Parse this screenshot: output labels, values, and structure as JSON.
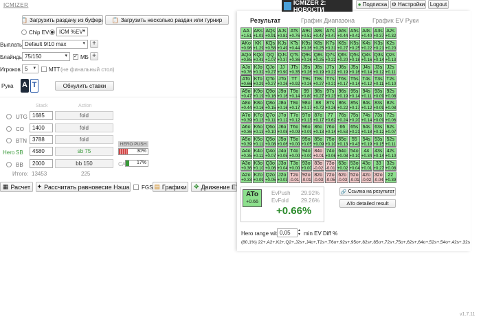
{
  "app": {
    "logo": "ICMIZER",
    "banner": "ICMIZER 2: НОВОСТИ",
    "version": "v1.7.11"
  },
  "topnav": {
    "subscription": "Подписка",
    "settings": "Настройки",
    "logout": "Logout"
  },
  "toolbar": {
    "load_hand": "Загрузить раздачу из буфера",
    "load_many": "Загрузить несколько раздач или турнир"
  },
  "model": {
    "chip_ev": "Chip EV",
    "icm": "ICM %EV"
  },
  "payouts": {
    "label": "Выплаты",
    "value": "Default 9/10 max"
  },
  "blinds": {
    "label": "Блайнды",
    "value": "75/150",
    "mb_label": "МБ"
  },
  "players": {
    "label": "Игроков",
    "value": "5",
    "mtt_label": "MTT",
    "final_note": "(не финальный стол)"
  },
  "hand": {
    "label": "Рука",
    "card1": "A",
    "card2": "T",
    "reset": "Обнулить ставки"
  },
  "table_head": {
    "stack": "Stack",
    "action": "Action"
  },
  "seats": [
    {
      "pos": "UTG",
      "stack": "1685",
      "action": "fold"
    },
    {
      "pos": "CO",
      "stack": "1400",
      "action": "fold"
    },
    {
      "pos": "BTN",
      "stack": "3788",
      "action": "fold"
    },
    {
      "pos": "SB",
      "hero": "Hero",
      "stack": "4580",
      "action": "sb 75"
    },
    {
      "pos": "BB",
      "stack": "2000",
      "action": "bb 150"
    }
  ],
  "totals": {
    "label": "Итого:",
    "stack": "13453",
    "action": "225"
  },
  "hero_push": {
    "label": "HERO PUSH",
    "value": "30%",
    "ca_label": "CA",
    "ca_value": "17%",
    "push_fraction": 0.3,
    "ca_fraction": 0.17
  },
  "bottom": {
    "calc": "Расчет",
    "nash": "Рассчитать равновесие Нэша",
    "fgs": "FGS",
    "graphs": "Графики",
    "ev_move": "Движение EV"
  },
  "tabs": {
    "result": "Результат",
    "range_graph": "График Диапазона",
    "ev_graph": "График EV Руки"
  },
  "summary": {
    "hand": "ATo",
    "hand_ev": "+0.66",
    "evpush_label": "EvPush",
    "evpush": "29.92%",
    "evfold_label": "EvFold",
    "evfold": "29.26%",
    "diff": "+0.66%",
    "link": "Ссылка на результат",
    "detailed": "ATo detailed result"
  },
  "hero_range": {
    "label": "Hero range with",
    "value": "0,05",
    "suffix": "min EV Diff %",
    "range": "(80,1%) 22+,A2+,K2+,Q2+,J2s+,J4o+,T2s+,T6o+,92s+,95o+,82s+,85o+,72s+,75o+,62s+,64o+,52s+,54o+,42s+,32s"
  },
  "grid": [
    [
      "AA",
      "+1.51",
      "g"
    ],
    [
      "AKs",
      "+1.03",
      "g"
    ],
    [
      "AQs",
      "+0.91",
      "g"
    ],
    [
      "AJs",
      "+0.81",
      "g"
    ],
    [
      "ATs",
      "+0.76",
      "g"
    ],
    [
      "A9s",
      "+0.52",
      "g"
    ],
    [
      "A8s",
      "+0.47",
      "g"
    ],
    [
      "A7s",
      "+0.47",
      "g"
    ],
    [
      "A6s",
      "+0.44",
      "g"
    ],
    [
      "A5s",
      "+0.42",
      "g"
    ],
    [
      "A4s",
      "+0.40",
      "g"
    ],
    [
      "A3s",
      "+0.37",
      "g"
    ],
    [
      "A2s",
      "+0.32",
      "g"
    ],
    [
      "AKo",
      "+0.96",
      "g"
    ],
    [
      "KK",
      "+1.29",
      "g"
    ],
    [
      "KQs",
      "+0.58",
      "g"
    ],
    [
      "KJs",
      "+0.49",
      "g"
    ],
    [
      "KTs",
      "+0.44",
      "g"
    ],
    [
      "K9s",
      "+0.36",
      "g"
    ],
    [
      "K8s",
      "+0.25",
      "g"
    ],
    [
      "K7s",
      "+0.31",
      "g"
    ],
    [
      "K6s",
      "+0.27",
      "g"
    ],
    [
      "K5s",
      "+0.25",
      "g"
    ],
    [
      "K4s",
      "+0.22",
      "g"
    ],
    [
      "K3s",
      "+0.21",
      "g"
    ],
    [
      "K2s",
      "+0.20",
      "g"
    ],
    [
      "AQo",
      "+0.85",
      "g"
    ],
    [
      "KQo",
      "+0.43",
      "g"
    ],
    [
      "QQ",
      "+1.07",
      "g"
    ],
    [
      "QJs",
      "+0.37",
      "g"
    ],
    [
      "QTs",
      "+0.36",
      "g"
    ],
    [
      "Q9s",
      "+0.26",
      "g"
    ],
    [
      "Q8s",
      "+0.25",
      "g"
    ],
    [
      "Q7s",
      "+0.22",
      "g"
    ],
    [
      "Q6s",
      "+0.20",
      "g"
    ],
    [
      "Q5s",
      "+0.18",
      "g"
    ],
    [
      "Q4s",
      "+0.16",
      "g"
    ],
    [
      "Q3s",
      "+0.14",
      "g"
    ],
    [
      "Q2s",
      "+0.13",
      "g"
    ],
    [
      "AJo",
      "+0.76",
      "g"
    ],
    [
      "KJo",
      "+0.32",
      "g"
    ],
    [
      "QJo",
      "+0.27",
      "g"
    ],
    [
      "JJ",
      "+0.90",
      "g"
    ],
    [
      "JTs",
      "+0.35",
      "g"
    ],
    [
      "J9s",
      "+0.26",
      "g"
    ],
    [
      "J8s",
      "+0.19",
      "g"
    ],
    [
      "J7s",
      "+0.22",
      "g"
    ],
    [
      "J6s",
      "+0.19",
      "g"
    ],
    [
      "J5s",
      "+0.16",
      "g"
    ],
    [
      "J4s",
      "+0.14",
      "g"
    ],
    [
      "J3s",
      "+0.12",
      "g"
    ],
    [
      "J2s",
      "+0.11",
      "g"
    ],
    [
      "ATo",
      "+0.66",
      "g"
    ],
    [
      "KTo",
      "+0.29",
      "g"
    ],
    [
      "QTo",
      "+0.27",
      "g"
    ],
    [
      "JTo",
      "+0.26",
      "g"
    ],
    [
      "TT",
      "+0.92",
      "g"
    ],
    [
      "T9s",
      "+0.26",
      "g"
    ],
    [
      "T8s",
      "+0.27",
      "g"
    ],
    [
      "T7s",
      "+0.21",
      "g"
    ],
    [
      "T6s",
      "+0.17",
      "g"
    ],
    [
      "T5s",
      "+0.14",
      "g"
    ],
    [
      "T4s",
      "+0.12",
      "g"
    ],
    [
      "T3s",
      "+0.11",
      "g"
    ],
    [
      "T2s",
      "+0.10",
      "g"
    ],
    [
      "A9o",
      "+0.47",
      "g"
    ],
    [
      "K9o",
      "+0.19",
      "g"
    ],
    [
      "Q9o",
      "+0.16",
      "g"
    ],
    [
      "J9o",
      "+0.16",
      "g"
    ],
    [
      "T9o",
      "+0.14",
      "g"
    ],
    [
      "99",
      "+0.80",
      "g"
    ],
    [
      "98s",
      "+0.27",
      "g"
    ],
    [
      "97s",
      "+0.23",
      "g"
    ],
    [
      "96s",
      "+0.19",
      "g"
    ],
    [
      "95s",
      "+0.14",
      "g"
    ],
    [
      "94s",
      "+0.11",
      "g"
    ],
    [
      "93s",
      "+0.09",
      "g"
    ],
    [
      "92s",
      "+0.08",
      "g"
    ],
    [
      "A8o",
      "+0.44",
      "g"
    ],
    [
      "K8o",
      "+0.16",
      "g"
    ],
    [
      "Q8o",
      "+0.15",
      "g"
    ],
    [
      "J8o",
      "+0.16",
      "g"
    ],
    [
      "T8o",
      "+0.17",
      "g"
    ],
    [
      "98o",
      "+0.17",
      "g"
    ],
    [
      "88",
      "+0.72",
      "g"
    ],
    [
      "87s",
      "+0.26",
      "g"
    ],
    [
      "86s",
      "+0.22",
      "g"
    ],
    [
      "85s",
      "+0.17",
      "g"
    ],
    [
      "84s",
      "+0.12",
      "g"
    ],
    [
      "83s",
      "+0.09",
      "g"
    ],
    [
      "82s",
      "+0.08",
      "g"
    ],
    [
      "A7o",
      "+0.39",
      "g"
    ],
    [
      "K7o",
      "+0.13",
      "g"
    ],
    [
      "Q7o",
      "+0.11",
      "g"
    ],
    [
      "J7o",
      "+0.12",
      "g"
    ],
    [
      "T7o",
      "+0.12",
      "g"
    ],
    [
      "97o",
      "+0.13",
      "g"
    ],
    [
      "87o",
      "+0.17",
      "g"
    ],
    [
      "77",
      "+0.62",
      "g"
    ],
    [
      "76s",
      "+0.24",
      "g"
    ],
    [
      "75s",
      "+0.20",
      "g"
    ],
    [
      "74s",
      "+0.14",
      "g"
    ],
    [
      "73s",
      "+0.09",
      "g"
    ],
    [
      "72s",
      "+0.06",
      "g"
    ],
    [
      "A6o",
      "+0.36",
      "g"
    ],
    [
      "K6o",
      "+0.13",
      "g"
    ],
    [
      "Q6o",
      "+0.10",
      "g"
    ],
    [
      "J6o",
      "+0.08",
      "g"
    ],
    [
      "T6o",
      "+0.09",
      "g"
    ],
    [
      "96o",
      "+0.09",
      "g"
    ],
    [
      "86o",
      "+0.13",
      "g"
    ],
    [
      "76o",
      "+0.14",
      "g"
    ],
    [
      "66",
      "+0.53",
      "g"
    ],
    [
      "65s",
      "+0.21",
      "g"
    ],
    [
      "64s",
      "+0.18",
      "g"
    ],
    [
      "63s",
      "+0.12",
      "g"
    ],
    [
      "62s",
      "+0.07",
      "g"
    ],
    [
      "A5o",
      "+0.39",
      "g"
    ],
    [
      "K5o",
      "+0.11",
      "g"
    ],
    [
      "Q5o",
      "+0.08",
      "g"
    ],
    [
      "J5o",
      "+0.06",
      "g"
    ],
    [
      "T5o",
      "+0.00",
      "g"
    ],
    [
      "95o",
      "+0.05",
      "g"
    ],
    [
      "85o",
      "+0.09",
      "g"
    ],
    [
      "75o",
      "+0.10",
      "g"
    ],
    [
      "65o",
      "+0.13",
      "g"
    ],
    [
      "55",
      "+0.43",
      "g"
    ],
    [
      "54s",
      "+0.19",
      "g"
    ],
    [
      "53s",
      "+0.15",
      "g"
    ],
    [
      "52s",
      "+0.11",
      "g"
    ],
    [
      "A4o",
      "+0.35",
      "g"
    ],
    [
      "K4o",
      "+0.11",
      "g"
    ],
    [
      "Q4o",
      "+0.07",
      "g"
    ],
    [
      "J4o",
      "+0.05",
      "g"
    ],
    [
      "T4o",
      "+0.00",
      "g"
    ],
    [
      "94o",
      "+0.00",
      "g"
    ],
    [
      "84o",
      "+0.01",
      "r"
    ],
    [
      "74o",
      "+0.06",
      "g"
    ],
    [
      "64o",
      "+0.08",
      "g"
    ],
    [
      "54o",
      "+0.10",
      "g"
    ],
    [
      "44",
      "+0.34",
      "g"
    ],
    [
      "43s",
      "+0.14",
      "g"
    ],
    [
      "42s",
      "+0.10",
      "g"
    ],
    [
      "A3o",
      "+0.36",
      "g"
    ],
    [
      "K3o",
      "+0.10",
      "g"
    ],
    [
      "Q3o",
      "+0.06",
      "g"
    ],
    [
      "J3o",
      "+0.04",
      "g"
    ],
    [
      "T3o",
      "+0.00",
      "g"
    ],
    [
      "93o",
      "+0.00",
      "g"
    ],
    [
      "83o",
      "-0.02",
      "r"
    ],
    [
      "73o",
      "-0.01",
      "r"
    ],
    [
      "63o",
      "+0.02",
      "g"
    ],
    [
      "53o",
      "+0.04",
      "g"
    ],
    [
      "43o",
      "+0.01",
      "g"
    ],
    [
      "33",
      "+0.27",
      "g"
    ],
    [
      "32s",
      "+0.08",
      "g"
    ],
    [
      "A2o",
      "+0.33",
      "g"
    ],
    [
      "K2o",
      "+0.09",
      "g"
    ],
    [
      "Q2o",
      "+0.05",
      "g"
    ],
    [
      "J2o",
      "+0.03",
      "g"
    ],
    [
      "T2o",
      "-0.01",
      "r"
    ],
    [
      "92o",
      "-0.01",
      "r"
    ],
    [
      "82o",
      "-0.03",
      "r"
    ],
    [
      "72o",
      "-0.05",
      "r"
    ],
    [
      "62o",
      "-0.03",
      "r"
    ],
    [
      "52o",
      "-0.01",
      "r"
    ],
    [
      "42o",
      "-0.02",
      "r"
    ],
    [
      "32o",
      "-0.04",
      "r"
    ],
    [
      "22",
      "+0.39",
      "g"
    ]
  ]
}
